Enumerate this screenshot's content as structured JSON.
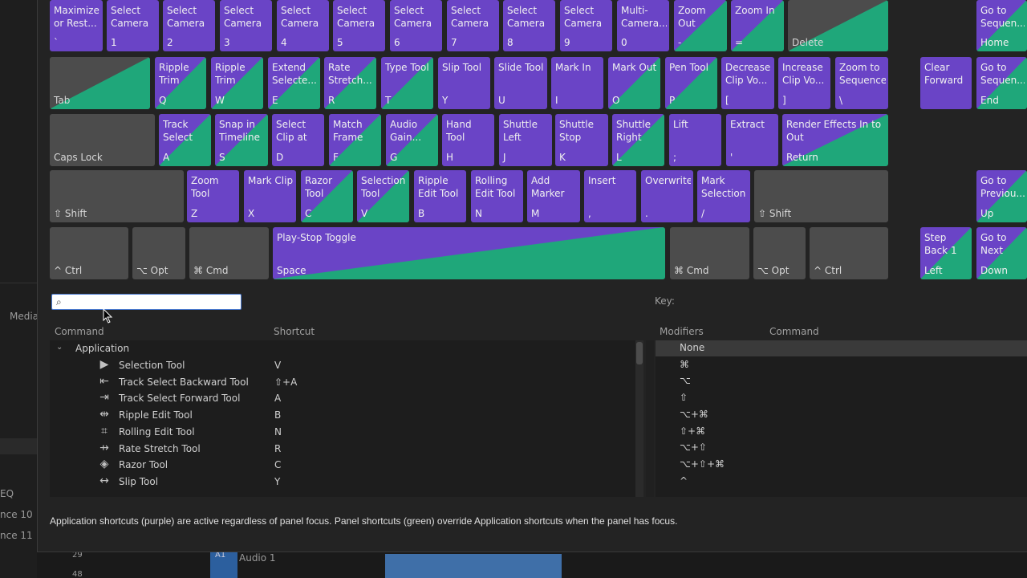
{
  "background": {
    "left_labels": [
      "Media",
      "EQ",
      "nce 10",
      "nce 11"
    ],
    "track_numbers": [
      "29",
      "48"
    ],
    "track_label": "A1",
    "audio_track": "Audio 1"
  },
  "keyboard": {
    "row1": [
      {
        "cmd": "Maximize or Rest...",
        "key": "`",
        "type": "app"
      },
      {
        "cmd": "Select Camera 1",
        "key": "1",
        "type": "app"
      },
      {
        "cmd": "Select Camera 2",
        "key": "2",
        "type": "app"
      },
      {
        "cmd": "Select Camera 3",
        "key": "3",
        "type": "app"
      },
      {
        "cmd": "Select Camera 4",
        "key": "4",
        "type": "app"
      },
      {
        "cmd": "Select Camera 5",
        "key": "5",
        "type": "app"
      },
      {
        "cmd": "Select Camera 6",
        "key": "6",
        "type": "app"
      },
      {
        "cmd": "Select Camera 7",
        "key": "7",
        "type": "app"
      },
      {
        "cmd": "Select Camera 8",
        "key": "8",
        "type": "app"
      },
      {
        "cmd": "Select Camera 9",
        "key": "9",
        "type": "app"
      },
      {
        "cmd": "Multi-Camera...",
        "key": "0",
        "type": "app"
      },
      {
        "cmd": "Zoom Out",
        "key": "-",
        "type": "app panel"
      },
      {
        "cmd": "Zoom In",
        "key": "=",
        "type": "app panel"
      },
      {
        "cmd": "",
        "key": "Delete",
        "type": "grey panel"
      }
    ],
    "row2": [
      {
        "cmd": "",
        "key": "Tab",
        "type": "grey panel"
      },
      {
        "cmd": "Ripple Trim",
        "key": "Q",
        "type": "app panel"
      },
      {
        "cmd": "Ripple Trim",
        "key": "W",
        "type": "app panel"
      },
      {
        "cmd": "Extend Selecte...",
        "key": "E",
        "type": "app panel"
      },
      {
        "cmd": "Rate Stretch...",
        "key": "R",
        "type": "app panel"
      },
      {
        "cmd": "Type Tool",
        "key": "T",
        "type": "app panel"
      },
      {
        "cmd": "Slip Tool",
        "key": "Y",
        "type": "app"
      },
      {
        "cmd": "Slide Tool",
        "key": "U",
        "type": "app"
      },
      {
        "cmd": "Mark In",
        "key": "I",
        "type": "app"
      },
      {
        "cmd": "Mark Out",
        "key": "O",
        "type": "app panel"
      },
      {
        "cmd": "Pen Tool",
        "key": "P",
        "type": "app panel"
      },
      {
        "cmd": "Decrease Clip Vo...",
        "key": "[",
        "type": "app"
      },
      {
        "cmd": "Increase Clip Vo...",
        "key": "]",
        "type": "app"
      },
      {
        "cmd": "Zoom to Sequence",
        "key": "\\",
        "type": "app"
      }
    ],
    "row3": [
      {
        "cmd": "",
        "key": "Caps Lock",
        "type": "grey"
      },
      {
        "cmd": "Track Select F...",
        "key": "A",
        "type": "app panel"
      },
      {
        "cmd": "Snap in Timeline",
        "key": "S",
        "type": "app panel"
      },
      {
        "cmd": "Select Clip at P...",
        "key": "D",
        "type": "app"
      },
      {
        "cmd": "Match Frame",
        "key": "F",
        "type": "app panel"
      },
      {
        "cmd": "Audio Gain...",
        "key": "G",
        "type": "app panel"
      },
      {
        "cmd": "Hand Tool",
        "key": "H",
        "type": "app"
      },
      {
        "cmd": "Shuttle Left",
        "key": "J",
        "type": "app"
      },
      {
        "cmd": "Shuttle Stop",
        "key": "K",
        "type": "app"
      },
      {
        "cmd": "Shuttle Right",
        "key": "L",
        "type": "app panel"
      },
      {
        "cmd": "Lift",
        "key": ";",
        "type": "app"
      },
      {
        "cmd": "Extract",
        "key": "'",
        "type": "app"
      },
      {
        "cmd": "Render Effects In to Out",
        "key": "Return",
        "type": "app panel"
      }
    ],
    "row4": [
      {
        "cmd": "",
        "key": "⇧ Shift",
        "type": "grey"
      },
      {
        "cmd": "Zoom Tool",
        "key": "Z",
        "type": "app"
      },
      {
        "cmd": "Mark Clip",
        "key": "X",
        "type": "app"
      },
      {
        "cmd": "Razor Tool",
        "key": "C",
        "type": "app panel"
      },
      {
        "cmd": "Selection Tool",
        "key": "V",
        "type": "app panel"
      },
      {
        "cmd": "Ripple Edit Tool",
        "key": "B",
        "type": "app"
      },
      {
        "cmd": "Rolling Edit Tool",
        "key": "N",
        "type": "app"
      },
      {
        "cmd": "Add Marker",
        "key": "M",
        "type": "app"
      },
      {
        "cmd": "Insert",
        "key": ",",
        "type": "app"
      },
      {
        "cmd": "Overwrite",
        "key": ".",
        "type": "app"
      },
      {
        "cmd": "Mark Selection",
        "key": "/",
        "type": "app"
      },
      {
        "cmd": "",
        "key": "⇧ Shift",
        "type": "grey"
      }
    ],
    "row5": [
      {
        "cmd": "",
        "key": "^ Ctrl",
        "type": "grey"
      },
      {
        "cmd": "",
        "key": "⌥ Opt",
        "type": "grey"
      },
      {
        "cmd": "",
        "key": "⌘ Cmd",
        "type": "grey"
      },
      {
        "cmd": "Play-Stop Toggle",
        "key": "Space",
        "type": "app panel"
      },
      {
        "cmd": "",
        "key": "⌘ Cmd",
        "type": "grey"
      },
      {
        "cmd": "",
        "key": "⌥ Opt",
        "type": "grey"
      },
      {
        "cmd": "",
        "key": "^ Ctrl",
        "type": "grey"
      }
    ],
    "nav": [
      {
        "cmd": "Go to Sequen...",
        "key": "Home",
        "type": "app panel"
      },
      {
        "cmd": "Clear Forward Delete",
        "key": "",
        "type": "app"
      },
      {
        "cmd": "Go to Sequen...",
        "key": "End",
        "type": "app panel"
      },
      {
        "cmd": "Go to Previou...",
        "key": "Up",
        "type": "app panel"
      },
      {
        "cmd": "Step Back 1 Frame",
        "key": "Left",
        "type": "app panel"
      },
      {
        "cmd": "Go to Next",
        "key": "Down",
        "type": "app panel"
      }
    ]
  },
  "search": {
    "placeholder": "",
    "value": ""
  },
  "command_list": {
    "headers": {
      "command": "Command",
      "shortcut": "Shortcut"
    },
    "group": "Application",
    "rows": [
      {
        "name": "Selection Tool",
        "shortcut": "V",
        "icon": "selection-arrow-icon"
      },
      {
        "name": "Track Select Backward Tool",
        "shortcut": "⇧+A",
        "icon": "track-select-backward-icon"
      },
      {
        "name": "Track Select Forward Tool",
        "shortcut": "A",
        "icon": "track-select-forward-icon"
      },
      {
        "name": "Ripple Edit Tool",
        "shortcut": "B",
        "icon": "ripple-edit-icon"
      },
      {
        "name": "Rolling Edit Tool",
        "shortcut": "N",
        "icon": "rolling-edit-icon"
      },
      {
        "name": "Rate Stretch Tool",
        "shortcut": "R",
        "icon": "rate-stretch-icon"
      },
      {
        "name": "Razor Tool",
        "shortcut": "C",
        "icon": "razor-icon"
      },
      {
        "name": "Slip Tool",
        "shortcut": "Y",
        "icon": "slip-icon"
      }
    ]
  },
  "key_panel": {
    "title": "Key:",
    "headers": {
      "modifiers": "Modifiers",
      "command": "Command"
    },
    "rows": [
      "None",
      "⌘",
      "⌥",
      "⇧",
      "⌥+⌘",
      "⇧+⌘",
      "⌥+⇧",
      "⌥+⇧+⌘",
      "^"
    ]
  },
  "footer": "Application shortcuts (purple) are active regardless of panel focus. Panel shortcuts (green) override Application shortcuts when the panel has focus.",
  "colors": {
    "app": "#6a44c6",
    "panel": "#1fa77a",
    "grey": "#4c4c4c"
  }
}
